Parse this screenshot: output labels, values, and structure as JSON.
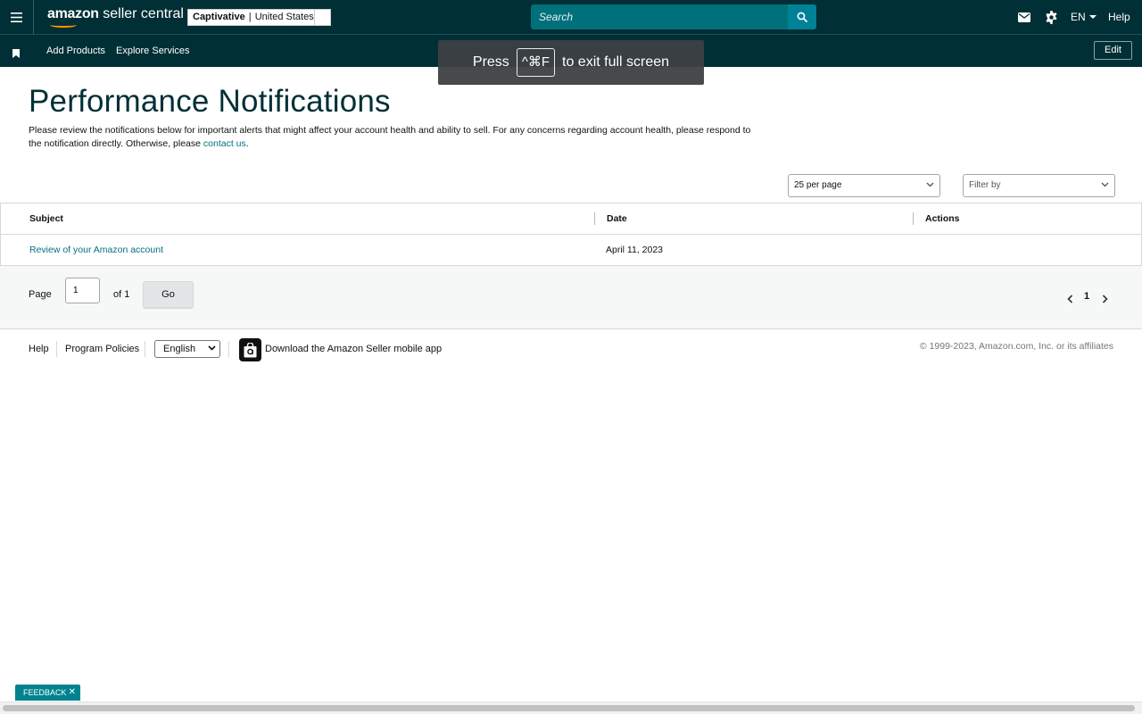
{
  "header": {
    "logo_brand": "amazon",
    "logo_product": "seller central",
    "store_name": "Captivative",
    "store_separator": "|",
    "store_region": "United States",
    "search_placeholder": "Search",
    "language": "EN",
    "help": "Help",
    "icons": [
      "menu-icon",
      "search-icon",
      "mail-icon",
      "gear-icon",
      "chevron-down-icon"
    ]
  },
  "subnav": {
    "items": [
      "Add Products",
      "Explore Services"
    ],
    "edit": "Edit"
  },
  "fullscreen_toast": {
    "press": "Press",
    "key": "^⌘F",
    "suffix": "to exit full screen"
  },
  "main": {
    "title": "Performance Notifications",
    "intro_text": "Please review the notifications below for important alerts that might affect your account health and ability to sell. For any concerns regarding account health, please respond to the notification directly. Otherwise, please ",
    "intro_link": "contact us",
    "intro_end": ".",
    "per_page": "25 per page",
    "filter": "Filter by",
    "table": {
      "columns": [
        "Subject",
        "Date",
        "Actions"
      ],
      "rows": [
        {
          "subject": "Review of your Amazon account",
          "date": "April 11, 2023",
          "actions": ""
        }
      ]
    },
    "pagination": {
      "page_label": "Page",
      "page_value": "1",
      "of_label": "of 1",
      "go": "Go",
      "current": "1"
    }
  },
  "footer": {
    "help": "Help",
    "policies": "Program Policies",
    "language": "English",
    "app_text": "Download the Amazon Seller mobile app",
    "copyright": "© 1999-2023, Amazon.com, Inc. or its affiliates"
  },
  "feedback": "FEEDBACK",
  "colors": {
    "nav_bg": "#002f36",
    "search_bg": "#00707a",
    "search_button": "#008296",
    "link": "#007185",
    "feedback_bg": "#00838f"
  }
}
